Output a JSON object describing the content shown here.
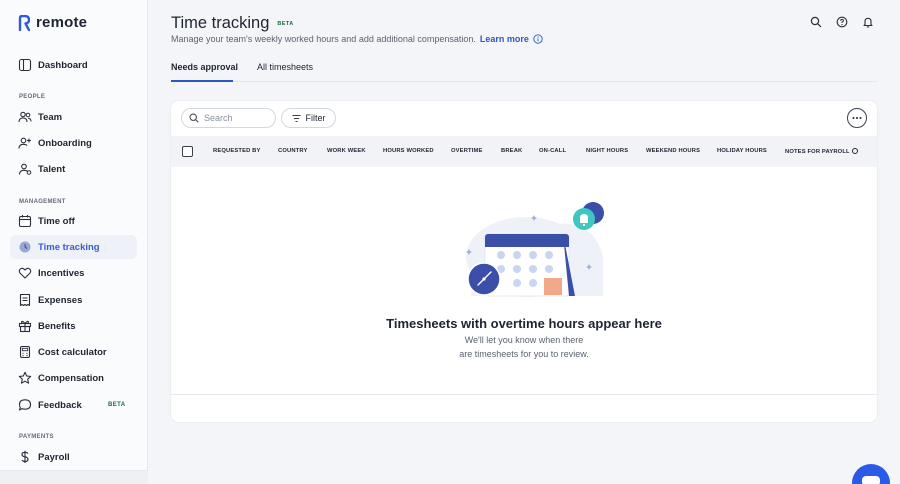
{
  "brand": {
    "name": "remote",
    "color": "#2b59e8"
  },
  "sidebar": {
    "top_items": [
      {
        "label": "Dashboard",
        "icon": "dashboard-icon"
      }
    ],
    "sections": [
      {
        "label": "PEOPLE",
        "items": [
          {
            "label": "Team",
            "icon": "team-icon"
          },
          {
            "label": "Onboarding",
            "icon": "onboarding-icon"
          },
          {
            "label": "Talent",
            "icon": "talent-icon"
          }
        ]
      },
      {
        "label": "MANAGEMENT",
        "items": [
          {
            "label": "Time off",
            "icon": "calendar-icon"
          },
          {
            "label": "Time tracking",
            "icon": "clock-icon",
            "active": true
          },
          {
            "label": "Incentives",
            "icon": "heart-icon"
          },
          {
            "label": "Expenses",
            "icon": "receipt-icon"
          },
          {
            "label": "Benefits",
            "icon": "gift-icon"
          },
          {
            "label": "Cost calculator",
            "icon": "calculator-icon"
          },
          {
            "label": "Compensation",
            "icon": "star-icon"
          },
          {
            "label": "Feedback",
            "icon": "chat-icon",
            "badge": "BETA"
          }
        ]
      },
      {
        "label": "PAYMENTS",
        "items": [
          {
            "label": "Payroll",
            "icon": "dollar-icon"
          }
        ]
      }
    ]
  },
  "header": {
    "title": "Time tracking",
    "badge": "BETA",
    "subtitle": "Manage your team's weekly worked hours and add additional compensation.",
    "learn_more": "Learn more"
  },
  "tabs": [
    {
      "label": "Needs approval",
      "active": true
    },
    {
      "label": "All timesheets",
      "active": false
    }
  ],
  "toolbar": {
    "search_placeholder": "Search",
    "filter_label": "Filter"
  },
  "table": {
    "columns": [
      "REQUESTED BY",
      "COUNTRY",
      "WORK WEEK",
      "HOURS WORKED",
      "OVERTIME",
      "BREAK",
      "ON-CALL",
      "NIGHT HOURS",
      "WEEKEND HOURS",
      "HOLIDAY HOURS",
      "NOTES FOR PAYROLL"
    ]
  },
  "empty_state": {
    "title": "Timesheets with overtime hours appear here",
    "line1": "We'll let you know when there",
    "line2": "are timesheets for you to review."
  },
  "colors": {
    "accent": "#2b59c3",
    "active_bg": "#eef1f8",
    "beta_green": "#1d6b45"
  }
}
